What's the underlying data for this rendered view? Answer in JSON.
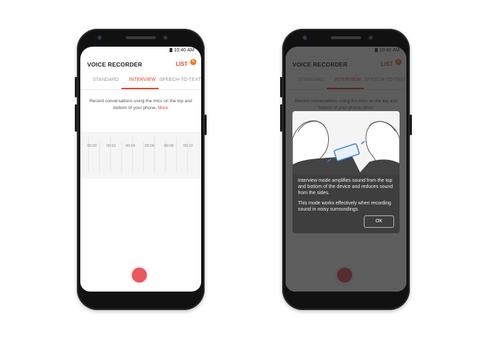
{
  "app": {
    "title": "VOICE RECORDER",
    "list_label": "LIST",
    "notification_count": "N"
  },
  "status": {
    "time": "10:40 AM"
  },
  "tabs": [
    {
      "label": "STANDARD",
      "active": false
    },
    {
      "label": "INTERVIEW",
      "active": true
    },
    {
      "label": "SPEECH-TO-TEXT",
      "active": false
    }
  ],
  "description": {
    "text": "Record conversations using the mics on the top and bottom of your phone.",
    "more_link": "More"
  },
  "timeline": {
    "ticks": [
      "00:00",
      "00:02",
      "00:04",
      "00:06",
      "00:08",
      "00:10"
    ]
  },
  "dialog": {
    "paragraph_1": "Interview mode amplifies sound from the top and bottom of the device and reduces sound from the sides.",
    "paragraph_2": "This mode works effectively when recording sound in noisy surroundings.",
    "ok_label": "OK"
  },
  "colors": {
    "accent": "#e3452e",
    "record_button": "#e8585d",
    "notification_badge": "#f47a1a",
    "dialog_bg": "#3e3e3e"
  },
  "icons": {
    "record": "record-icon",
    "battery": "battery-icon",
    "notification": "notification-badge"
  }
}
